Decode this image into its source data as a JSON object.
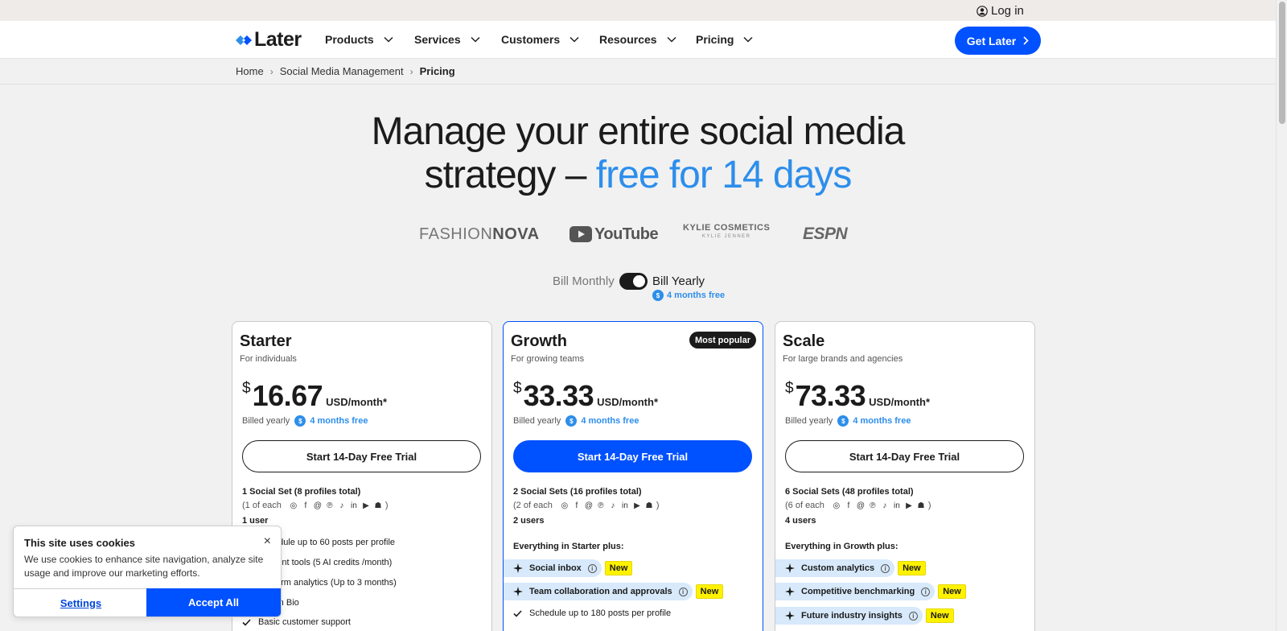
{
  "topbar": {
    "login_label": "Log in"
  },
  "nav": {
    "logo_text": "Later",
    "items": [
      {
        "label": "Products"
      },
      {
        "label": "Services"
      },
      {
        "label": "Customers"
      },
      {
        "label": "Resources"
      },
      {
        "label": "Pricing"
      }
    ],
    "cta_label": "Get Later"
  },
  "breadcrumb": {
    "home": "Home",
    "section": "Social Media Management",
    "current": "Pricing"
  },
  "hero": {
    "line1": "Manage your entire social media",
    "line2_prefix": "strategy –",
    "line2_highlight": "free for 14 days"
  },
  "logos": {
    "fashion_light": "FASHION",
    "fashion_bold": "NOVA",
    "youtube": "YouTube",
    "kylie_main": "KYLIE COSMETICS",
    "kylie_sub": "KYLIE JENNER",
    "espn": "ESPN"
  },
  "billing": {
    "monthly": "Bill Monthly",
    "yearly": "Bill Yearly",
    "free_note": "4 months free",
    "badge": "$"
  },
  "plans": [
    {
      "name": "Starter",
      "tagline": "For individuals",
      "currency": "$",
      "price": "16.67",
      "unit": "USD/month*",
      "billed": "Billed yearly",
      "free": "4 months free",
      "cta": "Start 14-Day Free Trial",
      "sets": "1 Social Set (8 profiles total)",
      "each_prefix": "(1 of each",
      "users": "1 user",
      "features": [
        "Schedule up to 60 posts per profile",
        "Content tools (5 AI credits /month)",
        "Platform analytics (Up to 3 months)",
        "Link in Bio",
        "Basic customer support"
      ]
    },
    {
      "name": "Growth",
      "tagline": "For growing teams",
      "badge": "Most popular",
      "currency": "$",
      "price": "33.33",
      "unit": "USD/month*",
      "billed": "Billed yearly",
      "free": "4 months free",
      "cta": "Start 14-Day Free Trial",
      "sets": "2 Social Sets (16 profiles total)",
      "each_prefix": "(2 of each",
      "users": "2 users",
      "plus": "Everything in Starter plus:",
      "highlights": [
        {
          "label": "Social inbox",
          "tag": "New"
        },
        {
          "label": "Team collaboration and approvals",
          "tag": "New"
        }
      ],
      "features": [
        "Schedule up to 180 posts per profile"
      ]
    },
    {
      "name": "Scale",
      "tagline": "For large brands and agencies",
      "currency": "$",
      "price": "73.33",
      "unit": "USD/month*",
      "billed": "Billed yearly",
      "free": "4 months free",
      "cta": "Start 14-Day Free Trial",
      "sets": "6 Social Sets (48 profiles total)",
      "each_prefix": "(6 of each",
      "users": "4 users",
      "plus": "Everything in Growth plus:",
      "highlights": [
        {
          "label": "Custom analytics",
          "tag": "New"
        },
        {
          "label": "Competitive benchmarking",
          "tag": "New"
        },
        {
          "label": "Future industry insights",
          "tag": "New"
        }
      ]
    }
  ],
  "cookie": {
    "title": "This site uses cookies",
    "text": "We use cookies to enhance site navigation, analyze site usage and improve our marketing efforts.",
    "settings": "Settings",
    "accept": "Accept All",
    "close": "×"
  },
  "colors": {
    "brand_blue": "#0051ff",
    "accent_blue": "#2d8eeb",
    "new_tag": "#fff200",
    "highlight_bg": "#d7e9fb"
  },
  "icons": {
    "social": [
      "instagram-icon",
      "facebook-icon",
      "threads-icon",
      "pinterest-icon",
      "tiktok-icon",
      "linkedin-icon",
      "youtube-icon",
      "snapchat-icon"
    ],
    "social_glyphs": [
      "◎",
      "f",
      "@",
      "℗",
      "♪",
      "in",
      "▶",
      "☗"
    ]
  }
}
